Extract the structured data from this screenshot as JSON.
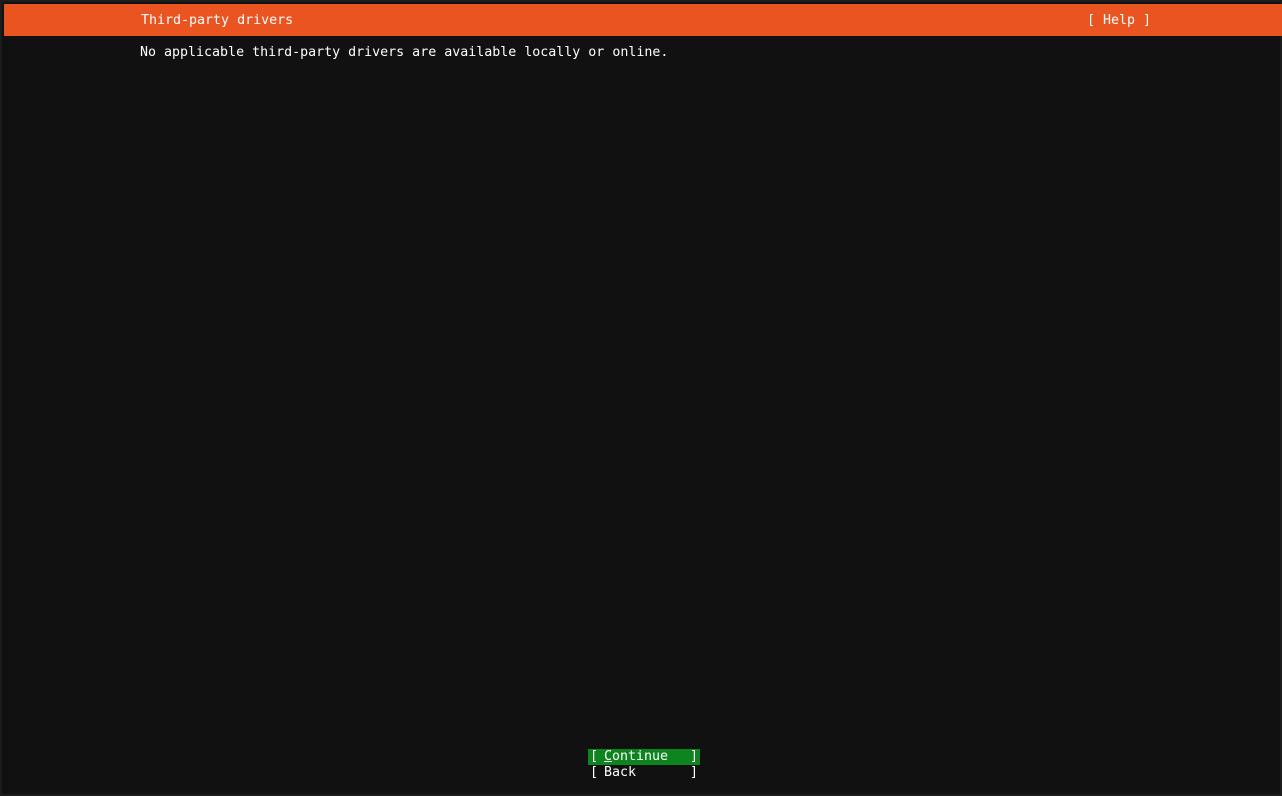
{
  "header": {
    "title": "Third-party drivers",
    "help_label": "[ Help ]"
  },
  "main": {
    "message": "No applicable third-party drivers are available locally or online."
  },
  "buttons": {
    "continue": {
      "left_bracket": "[",
      "accel": "C",
      "rest": "ontinue",
      "right_bracket": "]"
    },
    "back": {
      "left_bracket": "[",
      "label": "Back",
      "right_bracket": "]"
    }
  },
  "colors": {
    "header_bg": "#e95420",
    "page_bg": "#111111",
    "focused_button_bg": "#0e8420",
    "text": "#ffffff"
  }
}
